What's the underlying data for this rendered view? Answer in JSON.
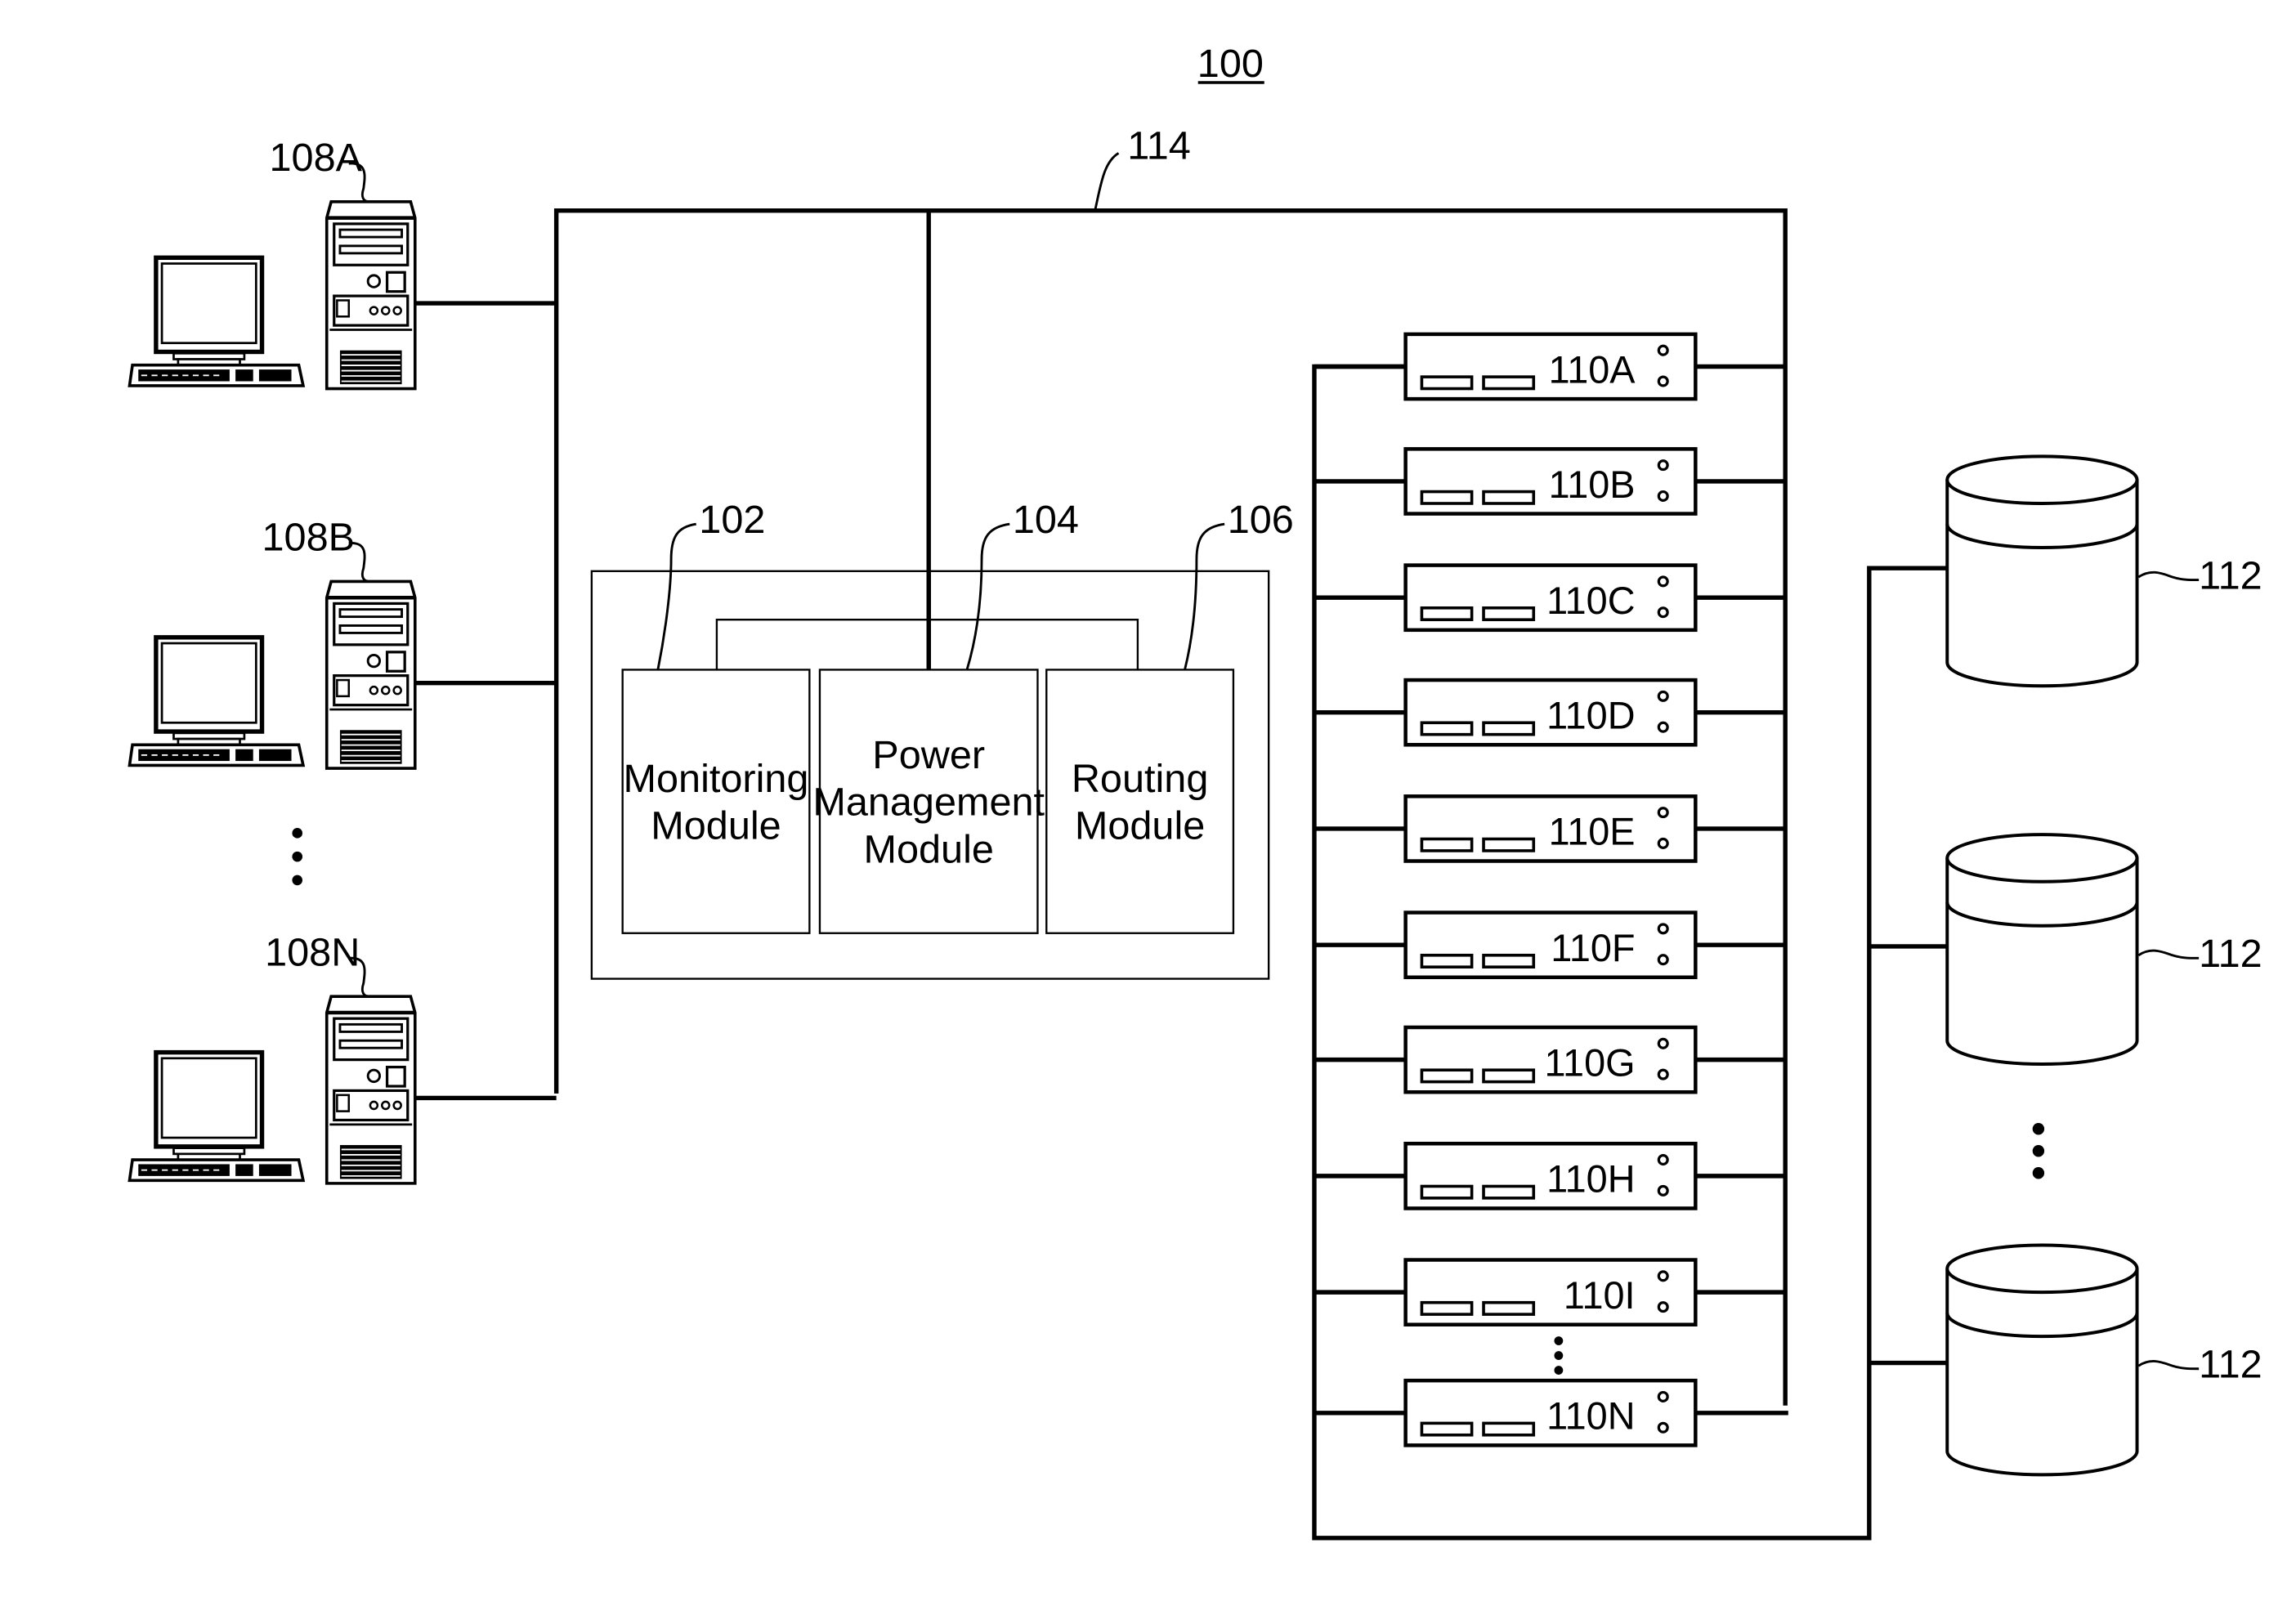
{
  "figure": {
    "number": "100"
  },
  "network": {
    "label": "114"
  },
  "clients": [
    {
      "label": "108A"
    },
    {
      "label": "108B"
    },
    {
      "label": "108N"
    }
  ],
  "modules": [
    {
      "ref": "102",
      "lines": [
        "Monitoring",
        "Module"
      ]
    },
    {
      "ref": "104",
      "lines": [
        "Power",
        "Management",
        "Module"
      ]
    },
    {
      "ref": "106",
      "lines": [
        "Routing",
        "Module"
      ]
    }
  ],
  "servers": [
    {
      "label": "110A"
    },
    {
      "label": "110B"
    },
    {
      "label": "110C"
    },
    {
      "label": "110D"
    },
    {
      "label": "110E"
    },
    {
      "label": "110F"
    },
    {
      "label": "110G"
    },
    {
      "label": "110H"
    },
    {
      "label": "110I"
    },
    {
      "label": "110N"
    }
  ],
  "storage": [
    {
      "label": "112"
    },
    {
      "label": "112"
    },
    {
      "label": "112"
    }
  ]
}
